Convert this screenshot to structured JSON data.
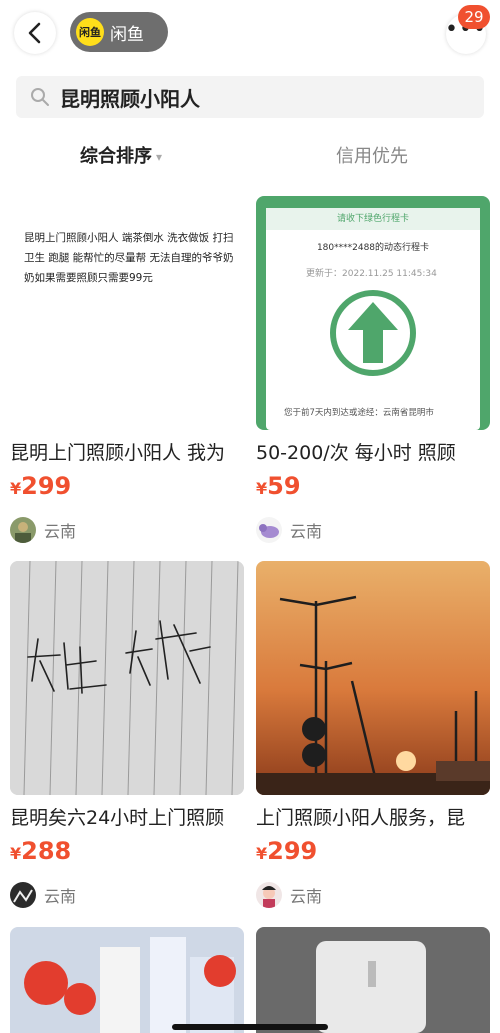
{
  "header": {
    "app_logo_text": "闲鱼",
    "app_name": "闲鱼",
    "notification_count": "29"
  },
  "search": {
    "query": "昆明照顾小阳人"
  },
  "sort": {
    "tab_main": "综合排序",
    "tab_credit": "信用优先"
  },
  "items": [
    {
      "title": "昆明上门照顾小阳人 我为",
      "currency": "¥",
      "price": "299",
      "location": "云南",
      "image_text": "昆明上门照顾小阳人  端茶倒水 洗衣做饭 打扫卫生  跑腿 能帮忙的尽量帮  无法自理的爷爷奶奶如果需要照顾只需要99元"
    },
    {
      "title": "50-200/次 每小时 照顾",
      "currency": "¥",
      "price": "59",
      "location": "云南",
      "image_text": {
        "header": "请收下绿色行程卡",
        "phone": "180****2488的动态行程卡",
        "time_label": "更新于：",
        "time": "2022.11.25 11:45:34",
        "footer": "您于前7天内到达或途经：云南省昆明市"
      }
    },
    {
      "title": "昆明矣六24小时上门照顾",
      "currency": "¥",
      "price": "288",
      "location": "云南"
    },
    {
      "title": "上门照顾小阳人服务，昆",
      "currency": "¥",
      "price": "299",
      "location": "云南"
    }
  ],
  "colors": {
    "accent": "#f0502f",
    "brand_yellow": "#ffde1a",
    "green": "#4fa66b"
  }
}
